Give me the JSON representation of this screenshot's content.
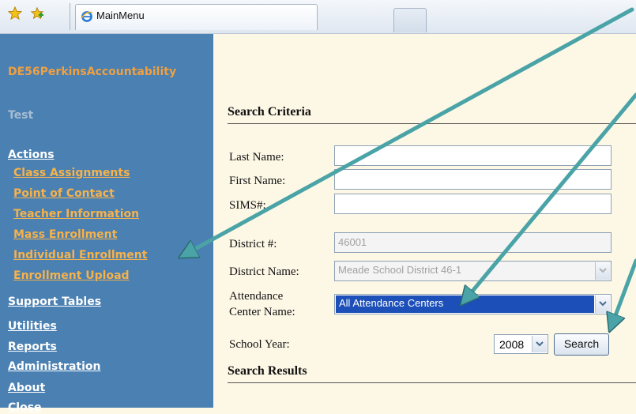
{
  "browser": {
    "tab_title": "MainMenu",
    "icons": [
      "favorites-star-icon",
      "add-favorites-icon",
      "ie-page-icon"
    ]
  },
  "sidebar": {
    "app_name": "DE56PerkinsAccountability",
    "environment": "Test",
    "items": [
      {
        "label": "Actions"
      },
      {
        "label": "Class Assignments"
      },
      {
        "label": "Point of Contact"
      },
      {
        "label": "Teacher Information"
      },
      {
        "label": "Mass Enrollment"
      },
      {
        "label": "Individual Enrollment"
      },
      {
        "label": "Enrollment Upload"
      },
      {
        "label": "Support Tables"
      },
      {
        "label": "Utilities"
      },
      {
        "label": "Reports"
      },
      {
        "label": "Administration"
      },
      {
        "label": "About"
      },
      {
        "label": "Close"
      }
    ]
  },
  "search": {
    "criteria_heading": "Search Criteria",
    "results_heading": "Search Results",
    "last_name_label": "Last Name:",
    "last_name_value": "",
    "first_name_label": "First Name:",
    "first_name_value": "",
    "sims_label": "SIMS#:",
    "sims_value": "",
    "district_number_label": "District #:",
    "district_number_value": "46001",
    "district_name_label": "District Name:",
    "district_name_value": "Meade School District 46-1",
    "attendance_label_line1": "Attendance",
    "attendance_label_line2": "Center Name:",
    "attendance_value": "All Attendance Centers",
    "school_year_label": "School Year:",
    "school_year_value": "2008",
    "search_button": "Search"
  },
  "colors": {
    "sidebar_bg": "#4a80b2",
    "app_name": "#f0a040",
    "sub_nav": "#f7b24a",
    "main_bg": "#fdf8e6",
    "selected_option_bg": "#1c4fb8",
    "annotation_arrow": "#4aa3a6"
  }
}
